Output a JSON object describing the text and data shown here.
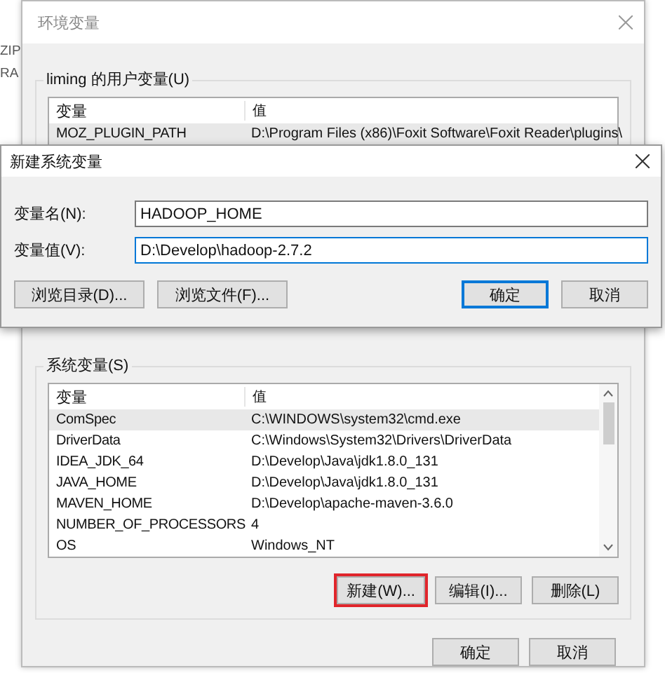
{
  "background_window_fragments": [
    "ZIP",
    "RA"
  ],
  "window": {
    "title": "环境变量"
  },
  "user_variables": {
    "label": "liming 的用户变量(U)",
    "columns": [
      "变量",
      "值"
    ],
    "rows": [
      {
        "name": "MOZ_PLUGIN_PATH",
        "value": "D:\\Program Files (x86)\\Foxit Software\\Foxit Reader\\plugins\\",
        "selected": true
      }
    ]
  },
  "system_variables": {
    "label": "系统变量(S)",
    "columns": [
      "变量",
      "值"
    ],
    "rows": [
      {
        "name": "ComSpec",
        "value": "C:\\WINDOWS\\system32\\cmd.exe",
        "selected": true
      },
      {
        "name": "DriverData",
        "value": "C:\\Windows\\System32\\Drivers\\DriverData",
        "selected": false
      },
      {
        "name": "IDEA_JDK_64",
        "value": "D:\\Develop\\Java\\jdk1.8.0_131",
        "selected": false
      },
      {
        "name": "JAVA_HOME",
        "value": "D:\\Develop\\Java\\jdk1.8.0_131",
        "selected": false
      },
      {
        "name": "MAVEN_HOME",
        "value": "D:\\Develop\\apache-maven-3.6.0",
        "selected": false
      },
      {
        "name": "NUMBER_OF_PROCESSORS",
        "value": "4",
        "selected": false
      },
      {
        "name": "OS",
        "value": "Windows_NT",
        "selected": false
      }
    ],
    "buttons": [
      {
        "label": "新建(W)...",
        "highlighted": true
      },
      {
        "label": "编辑(I)...",
        "highlighted": false
      },
      {
        "label": "删除(L)",
        "highlighted": false
      }
    ]
  },
  "buttons": [
    "确定",
    "取消"
  ],
  "dialog": {
    "title": "新建系统变量",
    "fields": [
      {
        "label": "变量名(N):",
        "value": "HADOOP_HOME",
        "focused": false
      },
      {
        "label": "变量值(V):",
        "value": "D:\\Develop\\hadoop-2.7.2",
        "focused": true
      }
    ],
    "browse_buttons": [
      "浏览目录(D)...",
      "浏览文件(F)..."
    ],
    "buttons": [
      {
        "label": "确定",
        "default": true
      },
      {
        "label": "取消",
        "default": false
      }
    ]
  }
}
